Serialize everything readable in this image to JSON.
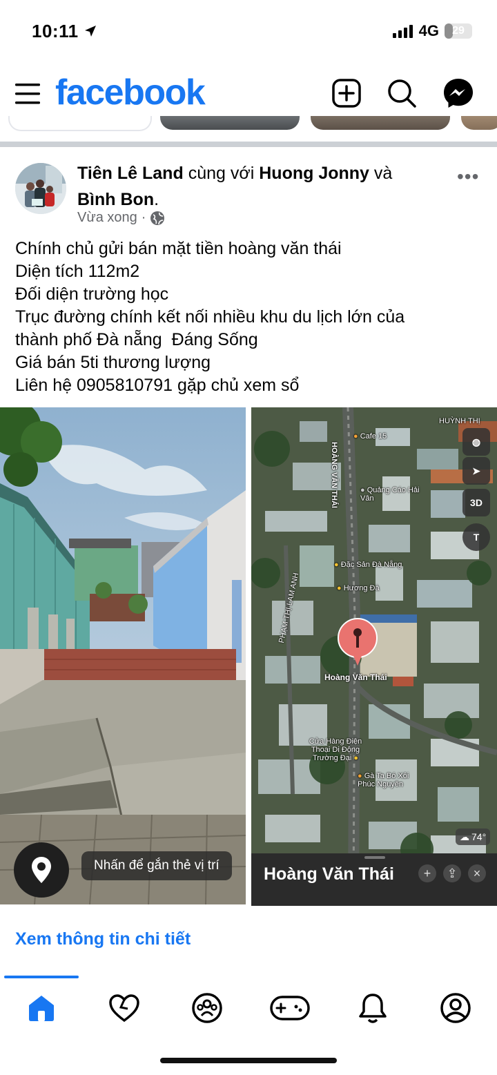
{
  "status_bar": {
    "time": "10:11",
    "network": "4G",
    "battery_level": "29"
  },
  "header": {
    "logo": "facebook",
    "icons": [
      "menu-icon",
      "plus-square-icon",
      "search-icon",
      "messenger-icon"
    ]
  },
  "post": {
    "author_name": "Tiên Lê Land",
    "with_text": "cùng với",
    "tagged_1": "Huong Jonny",
    "and_text": "và",
    "tagged_2": "Bình Bon",
    "timestamp": "Vừa xong",
    "text_lines": [
      "Chính chủ gửi bán mặt tiền hoàng văn thái",
      "Diện tích 112m2",
      "Đối diện trường học",
      "Trục đường chính kết nối nhiều khu du lịch lớn của",
      "thành phố Đà nẵng  Đáng Sống",
      "Giá bán 5ti thương lượng",
      "Liên hệ 0905810791 gặp chủ xem sổ"
    ],
    "photo_tag_hint": "Nhấn để gắn thẻ vị trí",
    "details_link": "Xem thông tin chi tiết"
  },
  "map": {
    "card_title": "Hoàng Văn Thái",
    "pin_label": "Hoàng Văn Thái",
    "controls": [
      "3D",
      "T"
    ],
    "weather": "74°",
    "places": [
      "Cafe 15",
      "Quảng Cáo Hải Vân",
      "Đặc Sản Đà Nẵng",
      "Hương Đà",
      "Cửa Hàng Điện Thoại Di Động Trường Đại",
      "Gà Ta Bó Xôi Phúc Nguyên",
      "HOÀNG VĂN THÁI",
      "PHẠM THỊ LAM ANH",
      "HUỲNH THỊ"
    ]
  },
  "bottom_nav": [
    "home-icon",
    "dating-heart-icon",
    "groups-icon",
    "gaming-icon",
    "notifications-bell-icon",
    "profile-icon"
  ],
  "colors": {
    "brand": "#1877f2",
    "text": "#050505",
    "secondary": "#65676b"
  }
}
